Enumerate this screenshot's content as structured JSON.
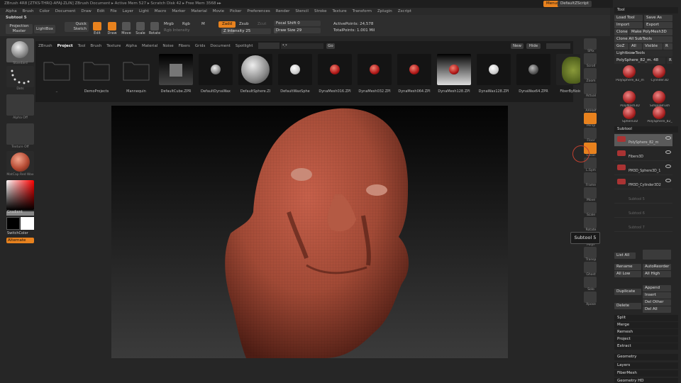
{
  "titlebar": {
    "text": "ZBrush 4R8 [ZTKS-THRQ-AFAJ-ZLIN]   ZBrush Document   ▸ Active Mem 527 ▸ Scratch Disk 42 ▸ Free Mem 3568 ▸▸"
  },
  "top_right": {
    "menus_label": "Menus",
    "script_label": "DefaultZScript"
  },
  "menubar": [
    "Alpha",
    "Brush",
    "Color",
    "Document",
    "Draw",
    "Edit",
    "File",
    "Layer",
    "Light",
    "Macro",
    "Marker",
    "Material",
    "Movie",
    "Picker",
    "Preferences",
    "Render",
    "Stencil",
    "Stroke",
    "Texture",
    "Transform",
    "Zplugin",
    "Zscript"
  ],
  "toolbar": {
    "subtool_title": "Subtool 5",
    "projection_master": "Projection Master",
    "lightbox": "LightBox",
    "quick_sketch": "Quick Sketch",
    "edit": "Edit",
    "draw": "Draw",
    "move": "Move",
    "scale": "Scale",
    "rotate": "Rotate",
    "mrgb": "Mrgb",
    "rgb": "Rgb",
    "m": "M",
    "rgb_intensity": "Rgb Intensity",
    "zadd": "Zadd",
    "zsub": "Zsub",
    "zcut": "Zcut",
    "z_intensity": "Z Intensity 25",
    "focal_shift": "Focal Shift 0",
    "draw_size": "Draw Size 29",
    "active_points": "ActivePoints: 24,578",
    "total_points": "TotalPoints: 1.001 Mil",
    "z_intensity_value": 25,
    "focal_shift_value": 0,
    "draw_size_value": 29
  },
  "left": {
    "brush_caption": "Standard",
    "stroke_caption": "Dots",
    "alpha_caption": "Alpha Off",
    "texture_caption": "Texture Off",
    "material_caption": "MatCap Red Wax",
    "gradient": "Gradient",
    "switch_color": "SwitchColor",
    "alternate": "Alternate"
  },
  "browser": {
    "tabs": [
      "ZBrush",
      "Project",
      "Tool",
      "Brush",
      "Texture",
      "Alpha",
      "Material",
      "Noise",
      "Fibers",
      "Grids",
      "Document",
      "Spotlight"
    ],
    "active_tab": "Project",
    "path": "*.*",
    "go": "Go",
    "new": "New",
    "hide": "Hide",
    "items": [
      {
        "label": "..",
        "kind": "folder"
      },
      {
        "label": "DemoProjects",
        "kind": "folder"
      },
      {
        "label": "Mannequin",
        "kind": "folder"
      },
      {
        "label": "DefaultCube.ZPR",
        "kind": "cube"
      },
      {
        "label": "DefaultDynaWax",
        "kind": "sphere-small-grey"
      },
      {
        "label": "DefaultSphere.ZI",
        "kind": "sphere-big-grey"
      },
      {
        "label": "DefaultWaxSphe",
        "kind": "sphere-small-white"
      },
      {
        "label": "DynaMesh016.ZPI",
        "kind": "sphere-red"
      },
      {
        "label": "DynaMesh032.ZPI",
        "kind": "sphere-red"
      },
      {
        "label": "DynaMesh064.ZPI",
        "kind": "sphere-red"
      },
      {
        "label": "DynaMesh128.ZPI",
        "kind": "sphere-red-glow"
      },
      {
        "label": "DynaWax128.ZPI",
        "kind": "sphere-small-white"
      },
      {
        "label": "DynaWax64.ZPR",
        "kind": "sphere-small-dark"
      },
      {
        "label": "FiberByNoise...",
        "kind": "plant"
      }
    ]
  },
  "rightstrip": [
    "SPix",
    "Scroll",
    "Zoom",
    "Actual",
    "AAHalf",
    "Persp",
    "Floor",
    "Local",
    "L.Sym",
    "Frame",
    "Move",
    "Scale",
    "Rotate",
    "PolyF",
    "Transp",
    "Ghost",
    "Solo",
    "Xpose"
  ],
  "tooltip": "Subtool 5",
  "tray": {
    "header": "Tool",
    "load_tool": "Load Tool",
    "save_as": "Save As",
    "import": "Import",
    "export": "Export",
    "clone": "Clone",
    "make_polymesh": "Make PolyMesh3D",
    "clone_all": "Clone All SubTools",
    "goz": "GoZ",
    "all": "All",
    "visible": "Visible",
    "r": "R",
    "lightbox_tools": "Lightbox▸Tools",
    "current_tool": "PolySphere_82_m. 48",
    "tool_thumbs": [
      "PolySphere_82_m",
      "Cylinder3D",
      "PolyMesh3D",
      "SimpleBrush",
      "Sphere3D",
      "PolySphere_82_"
    ],
    "subtool_header": "Subtool",
    "subtools": [
      "PolySphere_82_m",
      "Fibers3D",
      "PM3D_Sphere3D_1",
      "PM3D_Cylinder3D2",
      "Subtool 5",
      "Subtool 6",
      "Subtool 7"
    ],
    "list_all": "List All",
    "rename": "Rename",
    "auto_reorder": "AutoReorder",
    "all_low": "All Low",
    "all_high": "All High",
    "duplicate": "Duplicate",
    "append": "Append",
    "insert": "Insert",
    "delete": "Delete",
    "del_other": "Del Other",
    "del_all": "Del All",
    "split": "Split",
    "merge": "Merge",
    "remesh": "Remesh",
    "project": "Project",
    "extract": "Extract",
    "geometry": "Geometry",
    "layers": "Layers",
    "fibermesh": "FiberMesh",
    "geometry_hd": "Geometry HD"
  },
  "colors": {
    "accent": "#e8821e",
    "model": "#a84c38",
    "bg": "#262626"
  }
}
